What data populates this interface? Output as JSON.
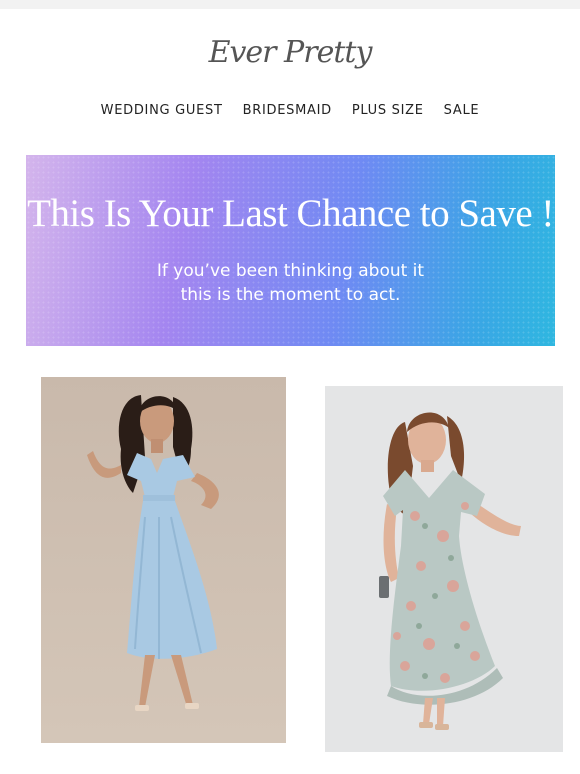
{
  "brand": {
    "logo_text": "Ever Pretty"
  },
  "nav": {
    "items": [
      {
        "label": "WEDDING GUEST"
      },
      {
        "label": "BRIDESMAID"
      },
      {
        "label": "PLUS SIZE"
      },
      {
        "label": "SALE"
      }
    ]
  },
  "banner": {
    "headline": "This Is Your Last Chance to Save !",
    "subline_1": "If you’ve been thinking about it",
    "subline_2": "this is the moment to act."
  },
  "products": [
    {
      "image": "model in light blue chiffon high-low dress",
      "dress_color": "#a9c9e3"
    },
    {
      "image": "model in sage floral wrap ruffle dress",
      "dress_color": "#b9c8c4"
    }
  ],
  "colors": {
    "banner_gradient_start": "#d4b5ec",
    "banner_gradient_end": "#2fb7e0"
  }
}
